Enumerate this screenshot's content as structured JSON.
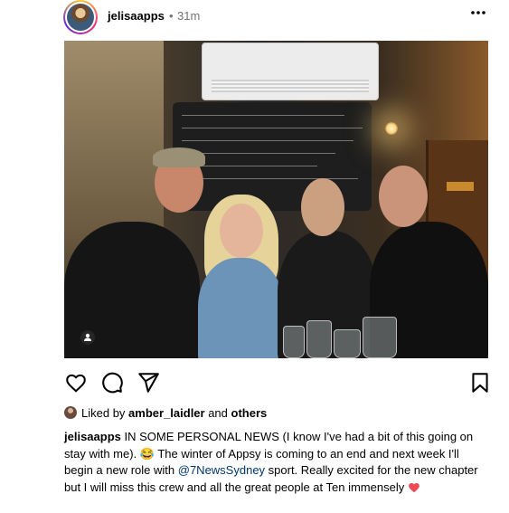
{
  "post": {
    "username": "jelisaapps",
    "separator": "•",
    "time": "31m",
    "more_icon": "more-horizontal-icon",
    "actions": {
      "like_icon": "heart-icon",
      "comment_icon": "comment-icon",
      "share_icon": "send-icon",
      "save_icon": "bookmark-icon"
    },
    "likes": {
      "prefix": "Liked by ",
      "user": "amber_laidler",
      "middle": " and ",
      "others": "others"
    },
    "caption": {
      "username": "jelisaapps",
      "text_1": " IN SOME PERSONAL NEWS (I know I've had a bit of this going on stay with me). 😂 The winter of Appsy is coming to an end and next week I'll begin a new role with ",
      "mention": "@7NewsSydney",
      "text_2": " sport. Really excited for the new chapter but I will miss this crew and all the great people at Ten immensely "
    }
  },
  "colors": {
    "mention": "#00376b",
    "muted": "#737373",
    "heart_emoji": "#ed4956"
  }
}
